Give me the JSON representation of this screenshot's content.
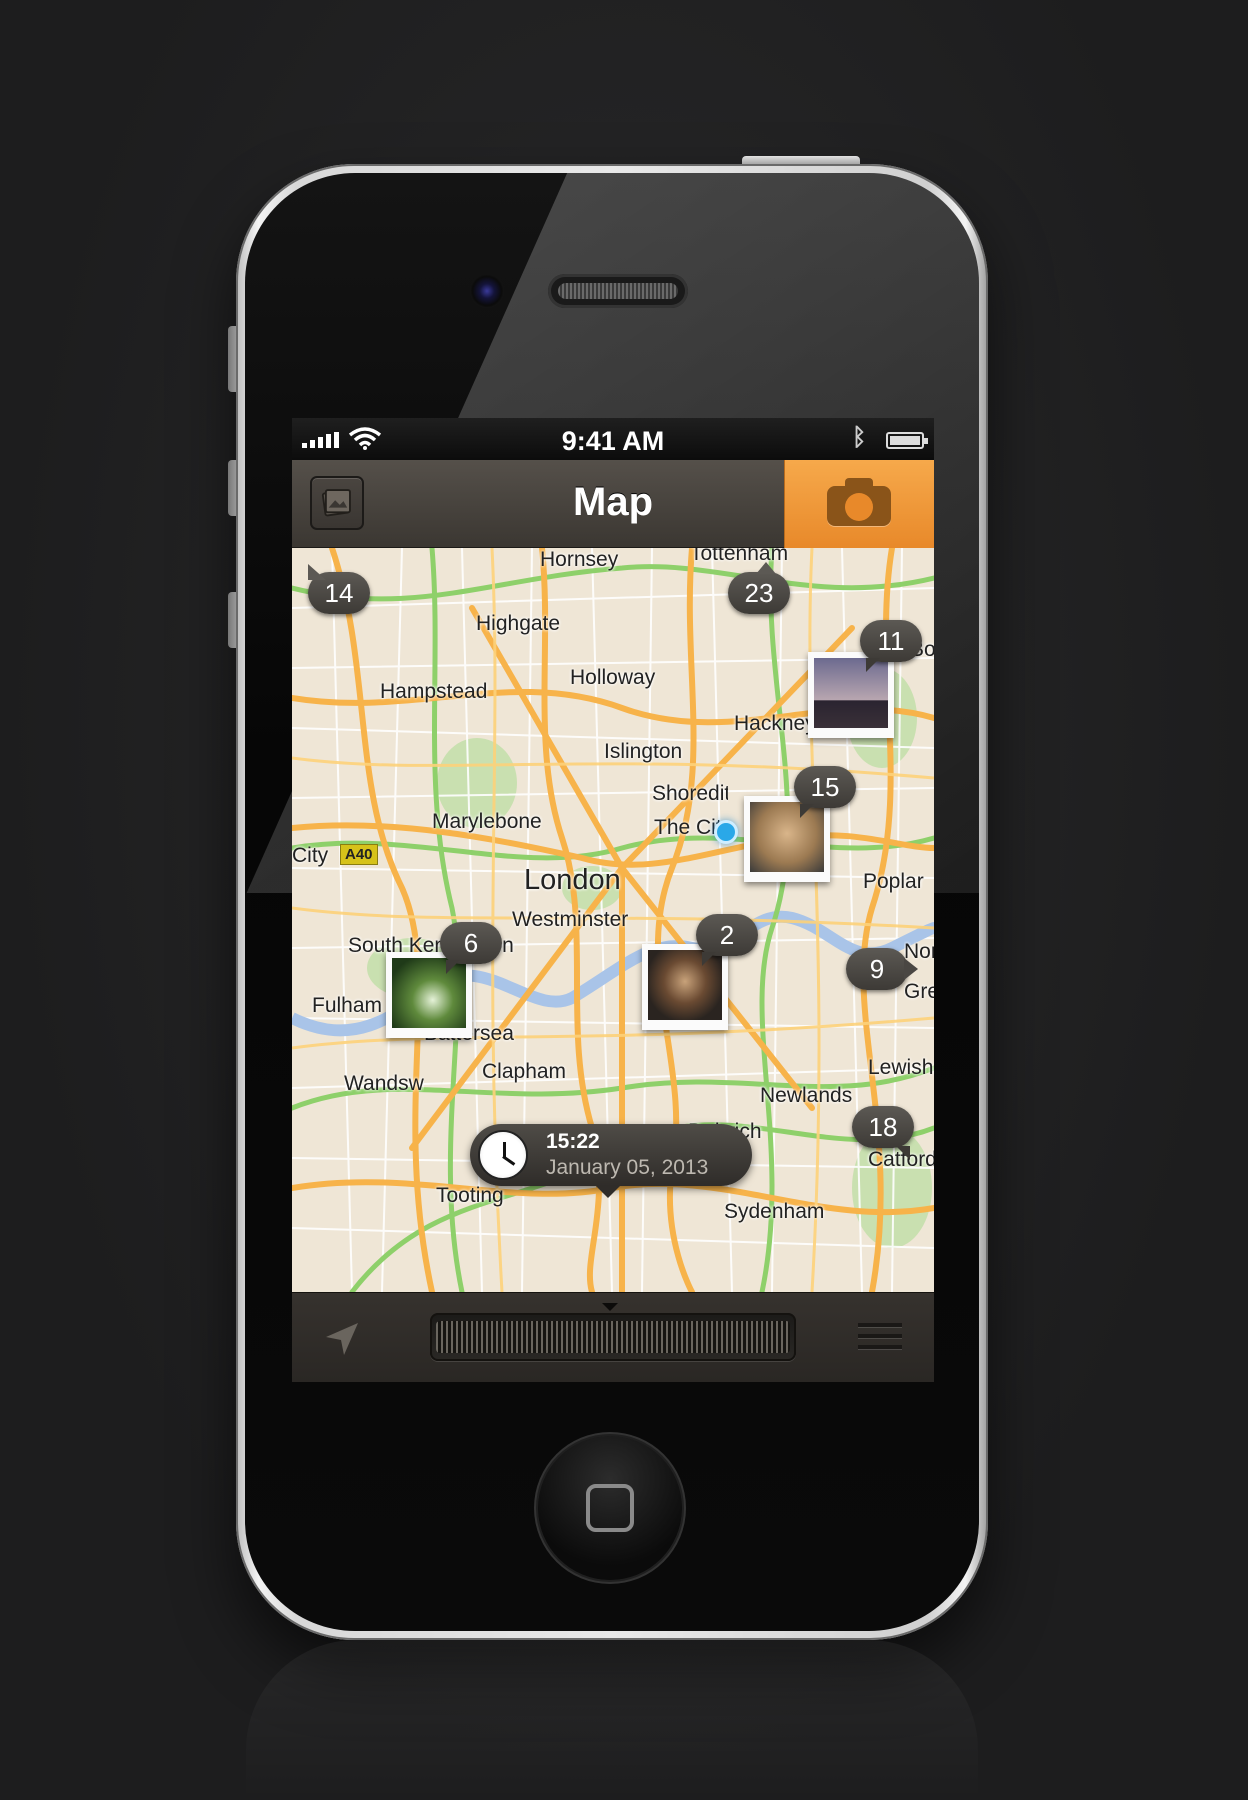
{
  "status_bar": {
    "time": "9:41 AM"
  },
  "nav": {
    "title": "Map"
  },
  "map": {
    "places": [
      "Hornsey",
      "Tottenham",
      "Highgate",
      "Holloway",
      "Hampstead",
      "Hackney",
      "Islington",
      "Shoreditch",
      "The City",
      "Marylebone",
      "City",
      "London",
      "Westminster",
      "Poplar",
      "South Kensington",
      "Fulham",
      "Battersea",
      "Clapham",
      "Wandsworth",
      "Lewisham",
      "Newlands",
      "Dulwich",
      "Catford",
      "Tooting",
      "Sydenham",
      "Greenwich",
      "North",
      "Bow"
    ],
    "road_badge": "A40",
    "clusters": [
      "14",
      "23",
      "11",
      "15",
      "6",
      "2",
      "9",
      "18"
    ],
    "current_time": "15:22",
    "current_date": "January 05, 2013"
  },
  "colors": {
    "accent": "#f0982f",
    "bar": "#3b3732",
    "bubble": "#4a4743"
  }
}
